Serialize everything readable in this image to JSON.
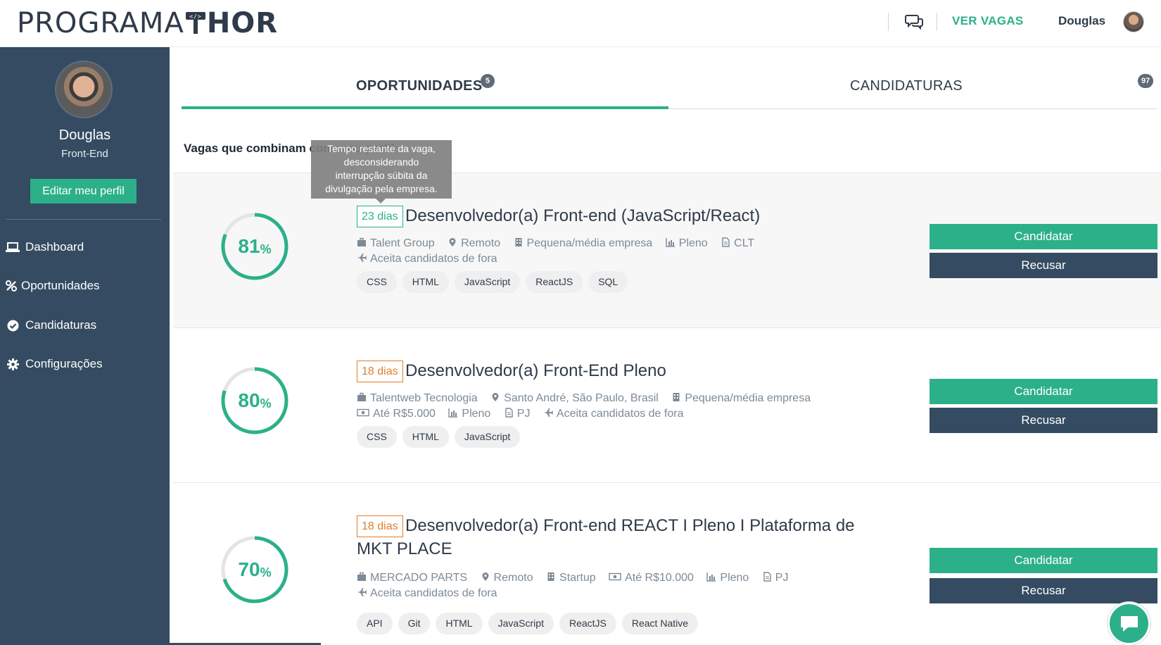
{
  "header": {
    "logo_left": "PROGRAMA",
    "logo_right": "HOR",
    "ver_vagas": "VER VAGAS",
    "user_name": "Douglas"
  },
  "sidebar": {
    "name": "Douglas",
    "role": "Front-End",
    "edit_button": "Editar meu perfil",
    "items": [
      {
        "label": "Dashboard",
        "icon": "laptop-icon"
      },
      {
        "label": "Oportunidades",
        "icon": "percent-icon"
      },
      {
        "label": "Candidaturas",
        "icon": "check-circle-icon"
      },
      {
        "label": "Configurações",
        "icon": "gear-icon"
      }
    ]
  },
  "tabs": [
    {
      "label": "OPORTUNIDADES",
      "badge": "5",
      "active": true
    },
    {
      "label": "CANDIDATURAS",
      "badge": "97",
      "active": false
    }
  ],
  "section_title": "Vagas que combinam com meu perfil",
  "tooltip": {
    "lines": [
      "Tempo restante da vaga,",
      "desconsiderando",
      "interrupção súbita da",
      "divulgação pela empresa."
    ]
  },
  "jobs": [
    {
      "score": "81",
      "score_fraction": 0.81,
      "days": "23 dias",
      "days_color": "#2cb08a",
      "title": "Desenvolvedor(a) Front-end (JavaScript/React)",
      "meta": [
        {
          "icon": "briefcase-icon",
          "text": "Talent Group"
        },
        {
          "icon": "map-pin-icon",
          "text": "Remoto"
        },
        {
          "icon": "building-icon",
          "text": "Pequena/média empresa"
        },
        {
          "icon": "bar-chart-icon",
          "text": "Pleno"
        },
        {
          "icon": "document-icon",
          "text": "CLT"
        },
        {
          "icon": "plane-icon",
          "text": "Aceita candidatos de fora"
        }
      ],
      "tags": [
        "CSS",
        "HTML",
        "JavaScript",
        "ReactJS",
        "SQL"
      ],
      "apply": "Candidatar",
      "refuse": "Recusar"
    },
    {
      "score": "80",
      "score_fraction": 0.8,
      "days": "18 dias",
      "days_color": "#e07d2c",
      "title": "Desenvolvedor(a) Front-End Pleno",
      "meta": [
        {
          "icon": "briefcase-icon",
          "text": "Talentweb Tecnologia"
        },
        {
          "icon": "map-pin-icon",
          "text": "Santo André, São Paulo, Brasil"
        },
        {
          "icon": "building-icon",
          "text": "Pequena/média empresa"
        },
        {
          "icon": "money-icon",
          "text": "Até R$5.000"
        },
        {
          "icon": "bar-chart-icon",
          "text": "Pleno"
        },
        {
          "icon": "document-icon",
          "text": "PJ"
        },
        {
          "icon": "plane-icon",
          "text": "Aceita candidatos de fora"
        }
      ],
      "tags": [
        "CSS",
        "HTML",
        "JavaScript"
      ],
      "apply": "Candidatar",
      "refuse": "Recusar"
    },
    {
      "score": "70",
      "score_fraction": 0.7,
      "days": "18 dias",
      "days_color": "#e07d2c",
      "title": "Desenvolvedor(a) Front-end REACT I Pleno I Plataforma de MKT PLACE",
      "meta": [
        {
          "icon": "briefcase-icon",
          "text": "MERCADO PARTS"
        },
        {
          "icon": "map-pin-icon",
          "text": "Remoto"
        },
        {
          "icon": "building-icon",
          "text": "Startup"
        },
        {
          "icon": "money-icon",
          "text": "Até R$10.000"
        },
        {
          "icon": "bar-chart-icon",
          "text": "Pleno"
        },
        {
          "icon": "document-icon",
          "text": "PJ"
        },
        {
          "icon": "plane-icon",
          "text": "Aceita candidatos de fora"
        }
      ],
      "tags": [
        "API",
        "Git",
        "HTML",
        "JavaScript",
        "ReactJS",
        "React Native"
      ],
      "apply": "Candidatar",
      "refuse": "Recusar"
    }
  ]
}
